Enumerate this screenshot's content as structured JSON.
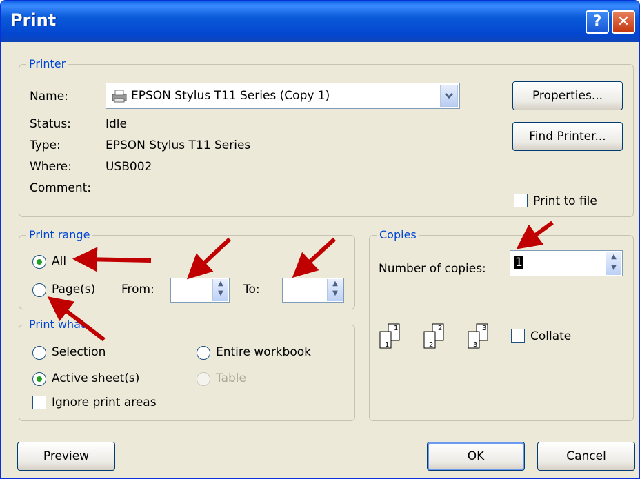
{
  "window": {
    "title": "Print",
    "help_glyph": "?",
    "close_glyph": "✕"
  },
  "printer": {
    "legend": "Printer",
    "name_label": "Name:",
    "name_value": "EPSON Stylus T11 Series (Copy 1)",
    "status_label": "Status:",
    "status_value": "Idle",
    "type_label": "Type:",
    "type_value": "EPSON Stylus T11 Series",
    "where_label": "Where:",
    "where_value": "USB002",
    "comment_label": "Comment:",
    "properties_button": "Properties...",
    "find_button": "Find Printer...",
    "print_to_file": "Print to file"
  },
  "print_range": {
    "legend": "Print range",
    "all_label": "All",
    "pages_label": "Page(s)",
    "from_label": "From:",
    "to_label": "To:",
    "from_value": "",
    "to_value": "",
    "selected": "all"
  },
  "print_what": {
    "legend": "Print what",
    "selection": "Selection",
    "active_sheets": "Active sheet(s)",
    "entire_workbook": "Entire workbook",
    "table": "Table",
    "ignore_areas": "Ignore print areas",
    "selected": "active_sheets"
  },
  "copies": {
    "legend": "Copies",
    "number_label": "Number of copies:",
    "number_value": "1",
    "collate_label": "Collate",
    "collate_checked": false,
    "page_digits": [
      "1",
      "2",
      "3"
    ]
  },
  "footer": {
    "preview": "Preview",
    "ok": "OK",
    "cancel": "Cancel"
  },
  "colors": {
    "accent": "#0046d5",
    "annotation_arrow": "#c00000",
    "titlebar": "#0347d1"
  }
}
